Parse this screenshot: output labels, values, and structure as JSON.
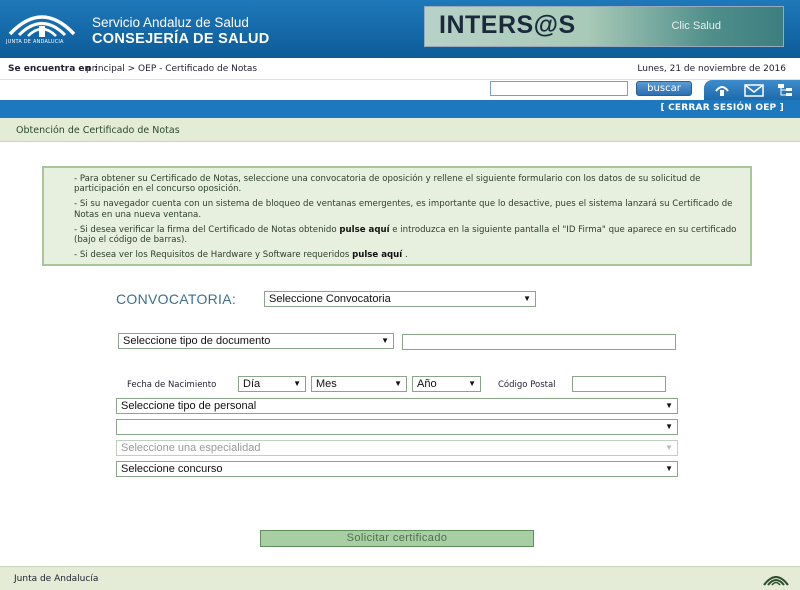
{
  "header": {
    "logo_caption": "JUNTA DE ANDALUCIA",
    "org_line1": "Servicio Andaluz de Salud",
    "org_line2": "CONSEJERÍA DE SALUD",
    "banner_title": "INTERS@S",
    "banner_subtitle": "Clic Salud"
  },
  "breadcrumb": {
    "lead": "Se encuentra en :",
    "path": "principal > OEP - Certificado de Notas",
    "date": "Lunes, 21 de noviembre de 2016"
  },
  "search": {
    "value": "",
    "button_label": "buscar"
  },
  "icons": [
    "home-icon",
    "mail-icon",
    "sitemap-icon"
  ],
  "session": {
    "logout_label": "[ CERRAR SESIÓN OEP ]"
  },
  "section": {
    "title": "Obtención de Certificado de Notas"
  },
  "info": {
    "p1": "- Para obtener su Certificado de Notas, seleccione una convocatoria de oposición y rellene el siguiente formulario con los datos de su solicitud de participación en el concurso oposición.",
    "p2": "- Si su navegador cuenta con un sistema de bloqueo de ventanas emergentes, es importante que lo desactive, pues el sistema lanzará su Certificado de Notas en una nueva ventana.",
    "p3_a": "- Si desea verificar la firma del Certificado de Notas obtenido ",
    "p3_link": "pulse aquí",
    "p3_b": " e introduzca en la siguiente pantalla el \"ID Firma\" que aparece en su certificado (bajo el código de barras).",
    "p4_a": "- Si desea ver los Requisitos de Hardware y Software requeridos ",
    "p4_link": "pulse aquí",
    "p4_b": " ."
  },
  "form": {
    "convocatoria_label": "CONVOCATORIA:",
    "convocatoria_value": "Seleccione Convocatoria",
    "doc_type_value": "Seleccione tipo de documento",
    "doc_number_value": "",
    "birth_label": "Fecha de Nacimiento",
    "day_value": "Día",
    "month_value": "Mes",
    "year_value": "Año",
    "postal_label": "Código Postal",
    "postal_value": "",
    "personal_value": "Seleccione tipo de personal",
    "category_value": "",
    "specialty_value": "Seleccione una especialidad",
    "contest_value": "Seleccione concurso",
    "submit_label": "Solicitar certificado"
  },
  "footer": {
    "text": "Junta de Andalucía"
  },
  "colors": {
    "header_blue": "#1e78bd",
    "panel_green": "#e4ebd6",
    "info_border": "#a7c79a",
    "label_blue": "#3e6f8f"
  }
}
